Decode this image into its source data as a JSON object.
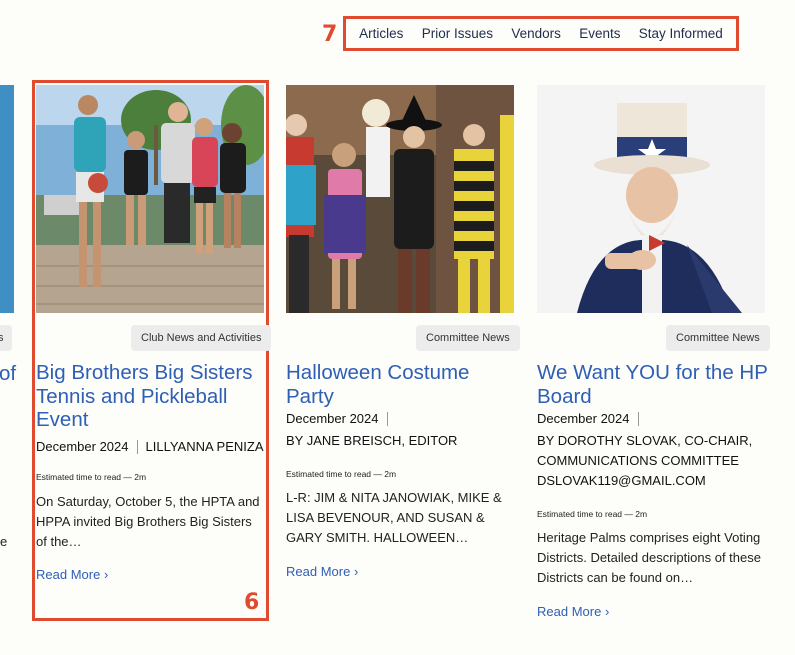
{
  "nav": {
    "items": [
      "Articles",
      "Prior Issues",
      "Vendors",
      "Events",
      "Stay Informed"
    ]
  },
  "markers": {
    "nav": "7",
    "card": "6"
  },
  "left_partial": {
    "badge": "s",
    "title": "of",
    "excerpt": "e"
  },
  "cards": [
    {
      "badge": "Club News and Activities",
      "title": "Big Brothers Big Sisters Tennis and Pickleball Event",
      "date": "December 2024",
      "author": "LILLYANNA PENIZA",
      "est": "Estimated time to read — 2m",
      "excerpt": "On Saturday, October 5, the HPTA and HPPA invited Big Brothers Big Sisters of the…",
      "read_more": "Read More"
    },
    {
      "badge": "Committee News",
      "title": "Halloween Costume Party",
      "date": "December 2024",
      "author": "BY JANE BREISCH, EDITOR",
      "est": "Estimated time to read — 2m",
      "excerpt": "L-R: JIM & NITA JANOWIAK, MIKE & LISA BEVENOUR, AND SUSAN & GARY SMITH. HALLOWEEN…",
      "read_more": "Read More"
    },
    {
      "badge": "Committee News",
      "title": "We Want YOU for the HP Board",
      "date": "December 2024",
      "author": "BY DOROTHY SLOVAK, CO-CHAIR, COMMUNICATIONS COMMITTEE DSLOVAK119@GMAIL.COM",
      "est": "Estimated time to read — 2m",
      "excerpt": "Heritage Palms comprises eight Voting Districts. Detailed descriptions of these Districts can be found on…",
      "read_more": "Read More"
    }
  ],
  "colors": {
    "accent": "#e04a2f",
    "link": "#2e5fb5",
    "badge_bg": "#ececec"
  },
  "icons": {
    "read_more": "chevron-right-icon"
  }
}
